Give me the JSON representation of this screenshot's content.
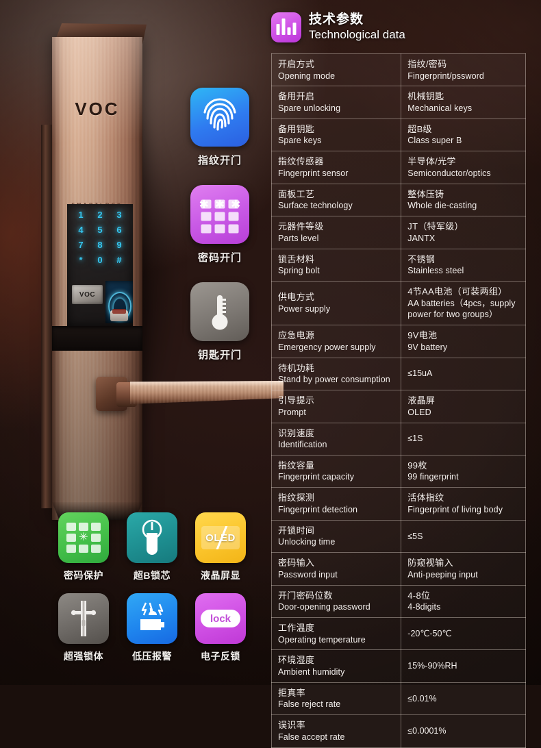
{
  "product": {
    "brand": "VOC",
    "sub_brand": "SMARTLOCK",
    "keypad_keys": [
      "1",
      "2",
      "3",
      "4",
      "5",
      "6",
      "7",
      "8",
      "9",
      "*",
      "0",
      "#"
    ],
    "display_text": "VOC"
  },
  "unlock_methods": [
    {
      "icon": "fingerprint-icon",
      "label": "指纹开门",
      "color": "#2f7bf0"
    },
    {
      "icon": "keypad-password-icon",
      "label": "密码开门",
      "color": "#c95ae6"
    },
    {
      "icon": "key-icon",
      "label": "钥匙开门",
      "color": "#7d7873"
    }
  ],
  "features": [
    {
      "icon": "password-protect-icon",
      "label": "密码保护",
      "color": "#44bf49"
    },
    {
      "icon": "lock-cylinder-icon",
      "label": "超B锁芯",
      "color": "#1e8f91"
    },
    {
      "icon": "oled-display-icon",
      "label": "液晶屏显",
      "color": "#fbc52c",
      "badge": "OLED"
    },
    {
      "icon": "lock-body-icon",
      "label": "超强锁体",
      "color": "#6e6a66"
    },
    {
      "icon": "low-voltage-alarm-icon",
      "label": "低压报警",
      "color": "#1f86ee"
    },
    {
      "icon": "electronic-deadbolt-icon",
      "label": "电子反锁",
      "color": "#cf4fe4",
      "badge": "lock"
    }
  ],
  "spec_panel": {
    "icon": "bar-chart-icon",
    "title_cn": "技术参数",
    "title_en": "Technological data",
    "rows": [
      {
        "key_cn": "开启方式",
        "key_en": "Opening mode",
        "val_cn": "指纹/密码",
        "val_en": "Fingerprint/pssword"
      },
      {
        "key_cn": "备用开启",
        "key_en": "Spare unlocking",
        "val_cn": "机械钥匙",
        "val_en": "Mechanical keys"
      },
      {
        "key_cn": "备用钥匙",
        "key_en": "Spare keys",
        "val_cn": "超B级",
        "val_en": "Class super B"
      },
      {
        "key_cn": "指纹传感器",
        "key_en": "Fingerprint sensor",
        "val_cn": "半导体/光学",
        "val_en": "Semiconductor/optics"
      },
      {
        "key_cn": "面板工艺",
        "key_en": "Surface technology",
        "val_cn": "整体压铸",
        "val_en": "Whole die-casting"
      },
      {
        "key_cn": "元器件等级",
        "key_en": "Parts level",
        "val_cn": "JT（特军级）",
        "val_en": "JANTX"
      },
      {
        "key_cn": "锁舌材料",
        "key_en": "Spring bolt",
        "val_cn": "不锈钢",
        "val_en": "Stainless steel"
      },
      {
        "key_cn": "供电方式",
        "key_en": "Power supply",
        "val_cn": "4节AA电池（可装两组）",
        "val_en": "AA batteries（4pcs，supply power for two groups）"
      },
      {
        "key_cn": "应急电源",
        "key_en": "Emergency power supply",
        "val_cn": "9V电池",
        "val_en": "9V battery"
      },
      {
        "key_cn": "待机功耗",
        "key_en": "Stand by power consumption",
        "val_single": "≤15uA"
      },
      {
        "key_cn": "引导提示",
        "key_en": "Prompt",
        "val_cn": "液晶屏",
        "val_en": "OLED"
      },
      {
        "key_cn": "识别速度",
        "key_en": "Identification",
        "val_single": "≤1S"
      },
      {
        "key_cn": "指纹容量",
        "key_en": "Fingerprint capacity",
        "val_cn": "99枚",
        "val_en": "99 fingerprint"
      },
      {
        "key_cn": "指纹探测",
        "key_en": "Fingerprint detection",
        "val_cn": "活体指纹",
        "val_en": "Fingerprint of living body"
      },
      {
        "key_cn": "开锁时间",
        "key_en": "Unlocking time",
        "val_single": "≤5S"
      },
      {
        "key_cn": "密码输入",
        "key_en": "Password input",
        "val_cn": "防窥视输入",
        "val_en": "Anti-peeping input"
      },
      {
        "key_cn": "开门密码位数",
        "key_en": "Door-opening password",
        "val_cn": "4-8位",
        "val_en": "4-8digits"
      },
      {
        "key_cn": "工作温度",
        "key_en": "Operating temperature",
        "val_single": "-20℃-50℃"
      },
      {
        "key_cn": "环境湿度",
        "key_en": "Ambient humidity",
        "val_single": "15%-90%RH"
      },
      {
        "key_cn": "拒真率",
        "key_en": "False reject rate",
        "val_single": "≤0.01%"
      },
      {
        "key_cn": "误识率",
        "key_en": "False accept rate",
        "val_single": "≤0.0001%"
      }
    ]
  }
}
